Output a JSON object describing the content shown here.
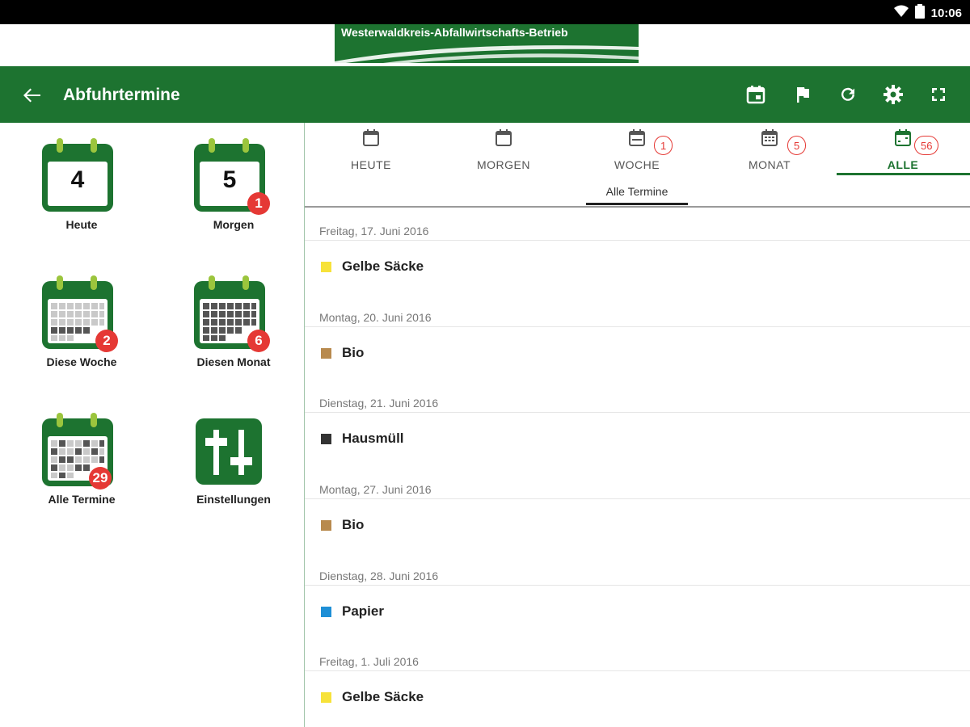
{
  "status_bar": {
    "time": "10:06",
    "icons": [
      "wifi-icon",
      "battery-icon"
    ]
  },
  "banner": {
    "text": "Westerwaldkreis-Abfallwirtschafts-Betrieb"
  },
  "toolbar": {
    "title": "Abfuhrtermine",
    "actions": [
      "calendar-event-icon",
      "flag-icon",
      "refresh-icon",
      "settings-icon",
      "fullscreen-icon"
    ]
  },
  "tiles": [
    {
      "label": "Heute",
      "day": "4",
      "badge": ""
    },
    {
      "label": "Morgen",
      "day": "5",
      "badge": "1"
    },
    {
      "label": "Diese Woche",
      "badge": "2"
    },
    {
      "label": "Diesen Monat",
      "badge": "6"
    },
    {
      "label": "Alle Termine",
      "badge": "29"
    },
    {
      "label": "Einstellungen",
      "badge": ""
    }
  ],
  "tabs": [
    {
      "label": "HEUTE",
      "count": ""
    },
    {
      "label": "MORGEN",
      "count": ""
    },
    {
      "label": "WOCHE",
      "count": "1"
    },
    {
      "label": "MONAT",
      "count": "5"
    },
    {
      "label": "ALLE",
      "count": "56"
    }
  ],
  "subtitle": "Alle Termine",
  "entries": [
    {
      "date": "Freitag, 17. Juni 2016",
      "type": "Gelbe Säcke",
      "color": "#f7e23a"
    },
    {
      "date": "Montag, 20. Juni 2016",
      "type": "Bio",
      "color": "#b88a4e"
    },
    {
      "date": "Dienstag, 21. Juni 2016",
      "type": "Hausmüll",
      "color": "#333333"
    },
    {
      "date": "Montag, 27. Juni 2016",
      "type": "Bio",
      "color": "#b88a4e"
    },
    {
      "date": "Dienstag, 28. Juni 2016",
      "type": "Papier",
      "color": "#1e8fd6"
    },
    {
      "date": "Freitag, 1. Juli 2016",
      "type": "Gelbe Säcke",
      "color": "#f7e23a"
    }
  ],
  "colors": {
    "brand_green": "#1d7330",
    "badge_red": "#e53935",
    "calendar_ring": "#9bc53d"
  }
}
